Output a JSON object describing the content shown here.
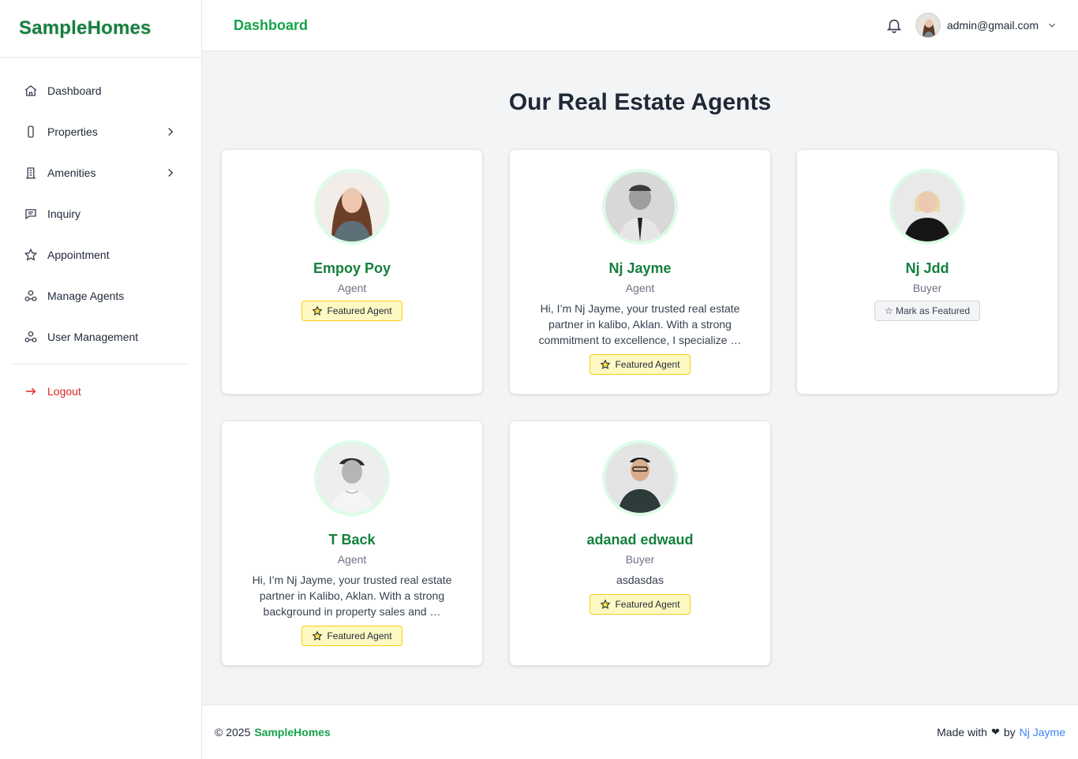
{
  "sidebar": {
    "brand": "SampleHomes",
    "items": [
      {
        "label": "Dashboard"
      },
      {
        "label": "Properties"
      },
      {
        "label": "Amenities"
      },
      {
        "label": "Inquiry"
      },
      {
        "label": "Appointment"
      },
      {
        "label": "Manage Agents"
      },
      {
        "label": "User Management"
      }
    ],
    "logout": "Logout"
  },
  "header": {
    "title": "Dashboard",
    "user_email": "admin@gmail.com"
  },
  "main": {
    "heading": "Our Real Estate Agents",
    "agents": [
      {
        "name": "Empoy Poy",
        "role": "Agent",
        "bio": "",
        "badge": "Featured Agent"
      },
      {
        "name": "Nj Jayme",
        "role": "Agent",
        "bio": "Hi, I’m Nj Jayme, your trusted real estate partner in kalibo, Aklan. With a strong commitment to excellence, I specialize …",
        "badge": "Featured Agent"
      },
      {
        "name": "Nj Jdd",
        "role": "Buyer",
        "bio": "",
        "badge": "☆ Mark as Featured"
      },
      {
        "name": "T Back",
        "role": "Agent",
        "bio": "Hi, I’m Nj Jayme, your trusted real estate partner in Kalibo, Aklan. With a strong background in property sales and …",
        "badge": "Featured Agent"
      },
      {
        "name": "adanad edwaud",
        "role": "Buyer",
        "bio": "asdasdas",
        "badge": "Featured Agent"
      }
    ]
  },
  "footer": {
    "copyright": "© 2025",
    "brand": "SampleHomes",
    "made_with": "Made with",
    "by": "by",
    "author": "Nj Jayme"
  },
  "colors": {
    "brand_green": "#15803d",
    "accent_green": "#16a34a",
    "logout_red": "#dc2626",
    "featured_bg": "#fef9c3",
    "link_blue": "#3b82f6"
  }
}
